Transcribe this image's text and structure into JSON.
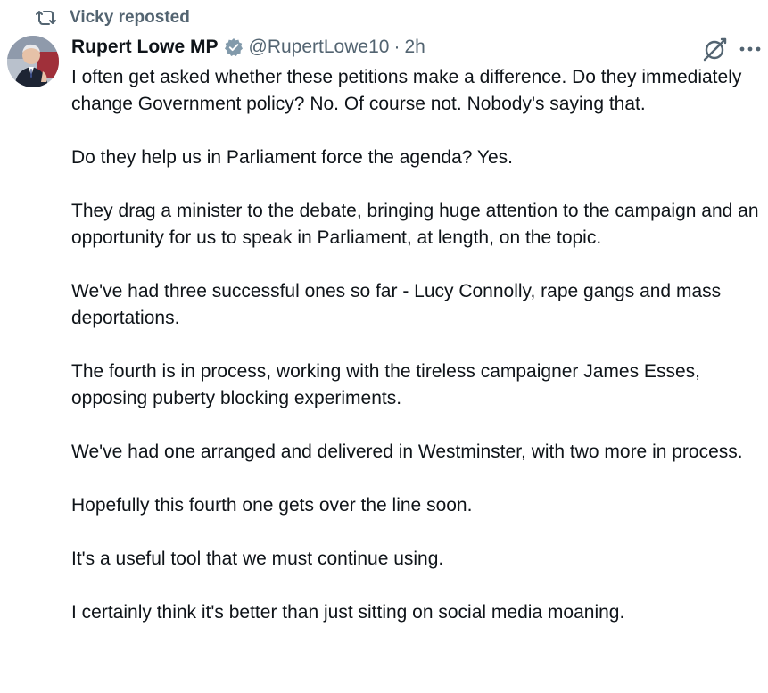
{
  "repost": {
    "label": "Vicky reposted",
    "icon": "repost-icon"
  },
  "author": {
    "display_name": "Rupert Lowe MP",
    "handle": "@RupertLowe10",
    "separator": "·",
    "time": "2h",
    "verified_color": "#829aab"
  },
  "icons": {
    "grok": "grok-icon",
    "more": "more-options-icon"
  },
  "tweet": {
    "paragraphs": [
      "I often get asked whether these petitions make a difference. Do they immediately change Government policy? No. Of course not. Nobody's saying that.",
      "Do they help us in Parliament force the agenda? Yes.",
      "They drag a minister to the debate, bringing huge attention to the campaign and an opportunity for us to speak in Parliament, at length, on the topic.",
      "We've had three successful ones so far - Lucy Connolly, rape gangs and mass deportations.",
      "The fourth is in process, working with the tireless campaigner James Esses, opposing puberty blocking experiments.",
      "We've had one arranged and delivered in Westminster, with two more in process.",
      "Hopefully this fourth one gets over the line soon.",
      "It's a useful tool that we must continue using.",
      "I certainly think it's better than just sitting on social media moaning."
    ]
  },
  "colors": {
    "text_primary": "#0f1419",
    "text_secondary": "#536471"
  }
}
